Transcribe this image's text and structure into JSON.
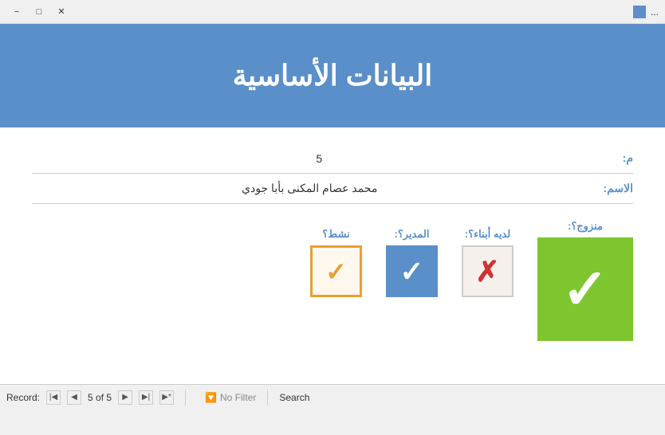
{
  "titlebar": {
    "icon": "db-icon",
    "text": "...",
    "minimize": "−",
    "maximize": "□",
    "close": "✕"
  },
  "header": {
    "title": "البيانات الأساسية"
  },
  "form": {
    "field_id_label": "م:",
    "field_id_value": "5",
    "field_name_label": "الاسم:",
    "field_name_value": "محمد عصام المكنى بأبا جودي"
  },
  "checkboxes": {
    "married_label": "منزوج؟:",
    "married_value": true,
    "children_label": "لديه أبناء؟:",
    "children_value": false,
    "manager_label": "المدير؟:",
    "manager_value": true,
    "active_label": "نشط؟",
    "active_value": true
  },
  "statusbar": {
    "record_label": "Record:",
    "nav_first": "◀|",
    "nav_prev": "◀",
    "record_count": "5 of 5",
    "nav_next": "▶",
    "nav_last": "|▶",
    "nav_new": "▶*",
    "filter_text": "No Filter",
    "search_placeholder": "Search",
    "search_value": "Search"
  }
}
